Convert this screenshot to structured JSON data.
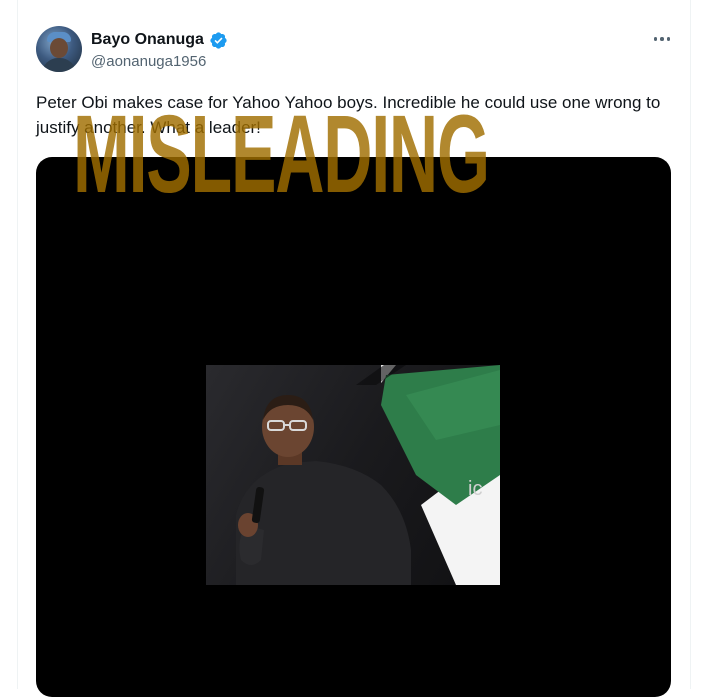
{
  "tweet": {
    "display_name": "Bayo Onanuga",
    "handle": "@aonanuga1956",
    "text": "Peter Obi makes case for Yahoo Yahoo boys. Incredible he could use one wrong to justify another. What a leader!",
    "verified": true,
    "more_icon": "more-horizontal-icon",
    "verified_icon": "verified-badge-icon"
  },
  "overlay": {
    "stamp": "MISLEADING",
    "stamp_color": "#a06e00"
  },
  "colors": {
    "text_primary": "#0f1419",
    "text_secondary": "#536471",
    "verified_blue": "#1d9bf0",
    "flag_green": "#1f7a3a"
  }
}
